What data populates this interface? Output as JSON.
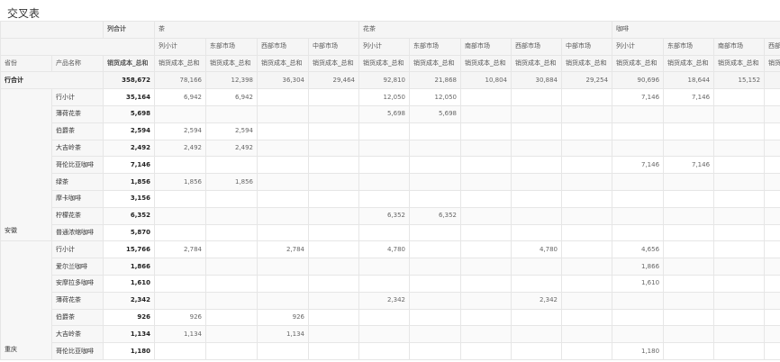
{
  "title": "交叉表",
  "header": {
    "total_col": "列合计",
    "groups": [
      "茶",
      "花茶",
      "咖啡"
    ],
    "sub_cols": [
      "列小计",
      "东部市场",
      "西部市场",
      "中部市场",
      "列小计",
      "东部市场",
      "南部市场",
      "西部市场",
      "中部市场",
      "列小计",
      "东部市场",
      "南部市场",
      "西部市场"
    ],
    "dim_province": "省份",
    "dim_product": "产品名称",
    "measure": "销货成本_总和",
    "row_total_label": "行合计",
    "row_total_values": [
      "358,672",
      "78,166",
      "12,398",
      "36,304",
      "29,464",
      "92,810",
      "21,868",
      "10,804",
      "30,884",
      "29,254",
      "90,696",
      "18,644",
      "15,152",
      ""
    ]
  },
  "groups": [
    {
      "province": "安徽",
      "rows": [
        {
          "name": "行小计",
          "values": [
            "35,164",
            "6,942",
            "6,942",
            "",
            "",
            "12,050",
            "12,050",
            "",
            "",
            "",
            "7,146",
            "7,146",
            "",
            ""
          ]
        },
        {
          "name": "薄荷花茶",
          "values": [
            "5,698",
            "",
            "",
            "",
            "",
            "5,698",
            "5,698",
            "",
            "",
            "",
            "",
            "",
            "",
            ""
          ]
        },
        {
          "name": "伯爵茶",
          "values": [
            "2,594",
            "2,594",
            "2,594",
            "",
            "",
            "",
            "",
            "",
            "",
            "",
            "",
            "",
            "",
            ""
          ]
        },
        {
          "name": "大吉岭茶",
          "values": [
            "2,492",
            "2,492",
            "2,492",
            "",
            "",
            "",
            "",
            "",
            "",
            "",
            "",
            "",
            "",
            ""
          ]
        },
        {
          "name": "哥伦比亚咖啡",
          "values": [
            "7,146",
            "",
            "",
            "",
            "",
            "",
            "",
            "",
            "",
            "",
            "7,146",
            "7,146",
            "",
            ""
          ]
        },
        {
          "name": "绿茶",
          "values": [
            "1,856",
            "1,856",
            "1,856",
            "",
            "",
            "",
            "",
            "",
            "",
            "",
            "",
            "",
            "",
            ""
          ]
        },
        {
          "name": "摩卡咖啡",
          "values": [
            "3,156",
            "",
            "",
            "",
            "",
            "",
            "",
            "",
            "",
            "",
            "",
            "",
            "",
            ""
          ]
        },
        {
          "name": "柠檬花茶",
          "values": [
            "6,352",
            "",
            "",
            "",
            "",
            "6,352",
            "6,352",
            "",
            "",
            "",
            "",
            "",
            "",
            ""
          ]
        },
        {
          "name": "普通浓缩咖啡",
          "values": [
            "5,870",
            "",
            "",
            "",
            "",
            "",
            "",
            "",
            "",
            "",
            "",
            "",
            "",
            ""
          ]
        }
      ]
    },
    {
      "province": "重庆",
      "rows": [
        {
          "name": "行小计",
          "values": [
            "15,766",
            "2,784",
            "",
            "2,784",
            "",
            "4,780",
            "",
            "",
            "4,780",
            "",
            "4,656",
            "",
            "",
            ""
          ]
        },
        {
          "name": "爱尔兰咖啡",
          "values": [
            "1,866",
            "",
            "",
            "",
            "",
            "",
            "",
            "",
            "",
            "",
            "1,866",
            "",
            "",
            ""
          ]
        },
        {
          "name": "安摩拉多咖啡",
          "values": [
            "1,610",
            "",
            "",
            "",
            "",
            "",
            "",
            "",
            "",
            "",
            "1,610",
            "",
            "",
            ""
          ]
        },
        {
          "name": "薄荷花茶",
          "values": [
            "2,342",
            "",
            "",
            "",
            "",
            "2,342",
            "",
            "",
            "2,342",
            "",
            "",
            "",
            "",
            ""
          ]
        },
        {
          "name": "伯爵茶",
          "values": [
            "926",
            "926",
            "",
            "926",
            "",
            "",
            "",
            "",
            "",
            "",
            "",
            "",
            "",
            ""
          ]
        },
        {
          "name": "大吉岭茶",
          "values": [
            "1,134",
            "1,134",
            "",
            "1,134",
            "",
            "",
            "",
            "",
            "",
            "",
            "",
            "",
            "",
            ""
          ]
        },
        {
          "name": "哥伦比亚咖啡",
          "values": [
            "1,180",
            "",
            "",
            "",
            "",
            "",
            "",
            "",
            "",
            "",
            "1,180",
            "",
            "",
            ""
          ]
        }
      ]
    }
  ]
}
